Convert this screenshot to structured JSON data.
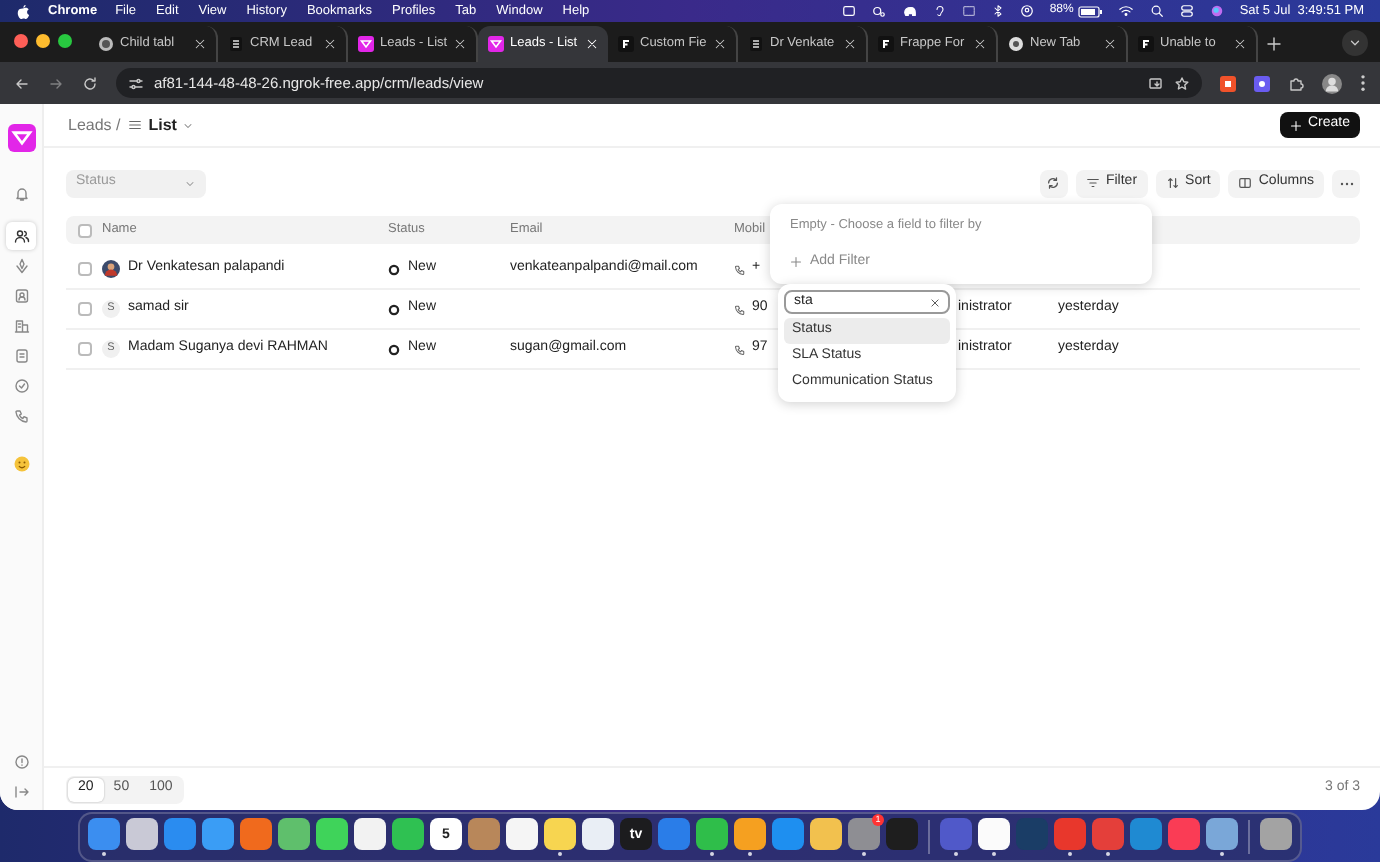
{
  "menu_bar": {
    "app": "Chrome",
    "items": [
      "File",
      "Edit",
      "View",
      "History",
      "Bookmarks",
      "Profiles",
      "Tab",
      "Window",
      "Help"
    ],
    "battery": "88%",
    "clock": "Sat 5 Jul  3:49:51 PM"
  },
  "browser": {
    "tabs": [
      {
        "title": "Child tabl",
        "kind": "globe",
        "selected": false
      },
      {
        "title": "CRM Lead",
        "kind": "doc",
        "selected": false
      },
      {
        "title": "Leads - List",
        "kind": "crm",
        "selected": false
      },
      {
        "title": "Leads - List",
        "kind": "crm",
        "selected": true
      },
      {
        "title": "Custom Fie",
        "kind": "frappe",
        "selected": false
      },
      {
        "title": "Dr Venkate",
        "kind": "doc",
        "selected": false
      },
      {
        "title": "Frappe For",
        "kind": "frappe",
        "selected": false
      },
      {
        "title": "New Tab",
        "kind": "chrome",
        "selected": false
      },
      {
        "title": "Unable to",
        "kind": "frappe",
        "selected": false
      }
    ],
    "url": "af81-144-48-48-26.ngrok-free.app/crm/leads/view"
  },
  "sidebar": {
    "items": [
      {
        "kind": "notifications",
        "selected": false
      },
      {
        "kind": "people",
        "selected": true
      },
      {
        "kind": "deals",
        "selected": false
      },
      {
        "kind": "contacts",
        "selected": false
      },
      {
        "kind": "organizations",
        "selected": false
      },
      {
        "kind": "notes",
        "selected": false
      },
      {
        "kind": "tasks",
        "selected": false
      },
      {
        "kind": "calls",
        "selected": false
      },
      {
        "kind": "smiley",
        "selected": false
      }
    ]
  },
  "header": {
    "breadcrumb_parent": "Leads /",
    "view": "List",
    "create_button": "Create"
  },
  "quick_filter": {
    "placeholder": "Status"
  },
  "toolbar": [
    "Filter",
    "Sort",
    "Columns"
  ],
  "table": {
    "select_all_checked": false,
    "columns": [
      "Name",
      "Status",
      "Email",
      "Mobil"
    ],
    "rows": [
      {
        "kind": "photo",
        "checked": false,
        "name": "Dr Venkatesan palapandi",
        "status": "New",
        "email": "venkateanpalpandi@mail.com",
        "mobile": "+"
      },
      {
        "kind": "letter",
        "checked": false,
        "avatar_letter": "S",
        "name": "samad sir",
        "status": "New",
        "mobile": "90",
        "owner": "inistrator",
        "modified": "yesterday"
      },
      {
        "kind": "letter",
        "checked": false,
        "avatar_letter": "S",
        "name": "Madam Suganya devi RAHMAN",
        "status": "New",
        "email": "sugan@gmail.com",
        "mobile": "97",
        "owner": "inistrator",
        "modified": "yesterday"
      }
    ]
  },
  "filter_popup": {
    "empty_text": "Empty - Choose a field to filter by",
    "add_filter": "Add Filter"
  },
  "field_search": {
    "value": "sta",
    "options": [
      {
        "label": "Status",
        "selected": true
      },
      {
        "label": "SLA Status",
        "selected": false
      },
      {
        "label": "Communication Status",
        "selected": false
      }
    ]
  },
  "footer": {
    "page_sizes": [
      {
        "label": "20",
        "selected": true
      },
      {
        "label": "50",
        "selected": false
      },
      {
        "label": "100",
        "selected": false
      }
    ],
    "count": "3 of 3"
  },
  "dock": {
    "apps": [
      {
        "kind": "app",
        "color": "#3b8ef0",
        "running": true
      },
      {
        "kind": "app",
        "color": "#c9c9d6",
        "running": false
      },
      {
        "kind": "app",
        "color": "#2a8cf0",
        "running": false
      },
      {
        "kind": "app",
        "color": "#3a9df5",
        "running": false
      },
      {
        "kind": "app",
        "color": "#f06a1d",
        "running": false
      },
      {
        "kind": "app",
        "color": "#5fbf6c",
        "running": false
      },
      {
        "kind": "app",
        "color": "#3fd35a",
        "running": false
      },
      {
        "kind": "app",
        "color": "#f2f2f2",
        "running": false
      },
      {
        "kind": "app",
        "color": "#2fc152",
        "running": false
      },
      {
        "kind": "app",
        "color": "#ffffff",
        "label": "5",
        "running": false
      },
      {
        "kind": "app",
        "color": "#b8875a",
        "running": false
      },
      {
        "kind": "app",
        "color": "#f5f5f5",
        "running": false
      },
      {
        "kind": "app",
        "color": "#f7d550",
        "running": true
      },
      {
        "kind": "app",
        "color": "#e9eef5",
        "running": false
      },
      {
        "kind": "app",
        "color": "#1c1c1e",
        "label": "tv",
        "running": false
      },
      {
        "kind": "app",
        "color": "#2a7de8",
        "running": false
      },
      {
        "kind": "app",
        "color": "#2fbe4a",
        "running": true
      },
      {
        "kind": "app",
        "color": "#f5a020",
        "running": true
      },
      {
        "kind": "app",
        "color": "#1e8ff0",
        "running": false
      },
      {
        "kind": "app",
        "color": "#f2c14e",
        "running": false
      },
      {
        "kind": "app",
        "color": "#8e8e93",
        "badge": "1",
        "running": true
      },
      {
        "kind": "app",
        "color": "#1e1e1e",
        "running": false
      },
      {
        "kind": "divider"
      },
      {
        "kind": "app",
        "color": "#5059c9",
        "running": true
      },
      {
        "kind": "app",
        "color": "#fbfbfb",
        "running": true
      },
      {
        "kind": "app",
        "color": "#1a3d66",
        "running": false
      },
      {
        "kind": "app",
        "color": "#e8372c",
        "running": true
      },
      {
        "kind": "app",
        "color": "#e43f3a",
        "running": true
      },
      {
        "kind": "app",
        "color": "#1f8ad2",
        "running": false
      },
      {
        "kind": "app",
        "color": "#fa3c55",
        "running": false
      },
      {
        "kind": "app",
        "color": "#7aa7d8",
        "running": true
      },
      {
        "kind": "divider"
      },
      {
        "kind": "app",
        "color": "#a3a3a3",
        "running": false
      }
    ]
  }
}
